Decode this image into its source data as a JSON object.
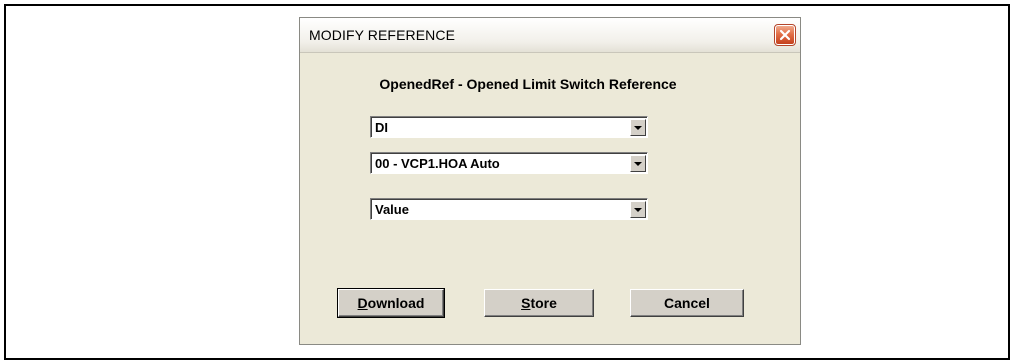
{
  "dialog": {
    "title": "MODIFY REFERENCE",
    "heading": "OpenedRef - Opened Limit Switch Reference"
  },
  "fields": {
    "type": {
      "value": "DI"
    },
    "point": {
      "value": "00 - VCP1.HOA Auto"
    },
    "attribute": {
      "value": "Value"
    }
  },
  "buttons": {
    "download": {
      "mnemonic": "D",
      "rest": "ownload"
    },
    "store": {
      "mnemonic": "S",
      "rest": "tore"
    },
    "cancel": {
      "label": "Cancel"
    }
  },
  "icons": {
    "close": "close-icon",
    "dropdown": "chevron-down-icon"
  },
  "colors": {
    "dialog_bg": "#ece9d8",
    "close_button": "#e26f47",
    "button_face": "#d4d0c8"
  }
}
